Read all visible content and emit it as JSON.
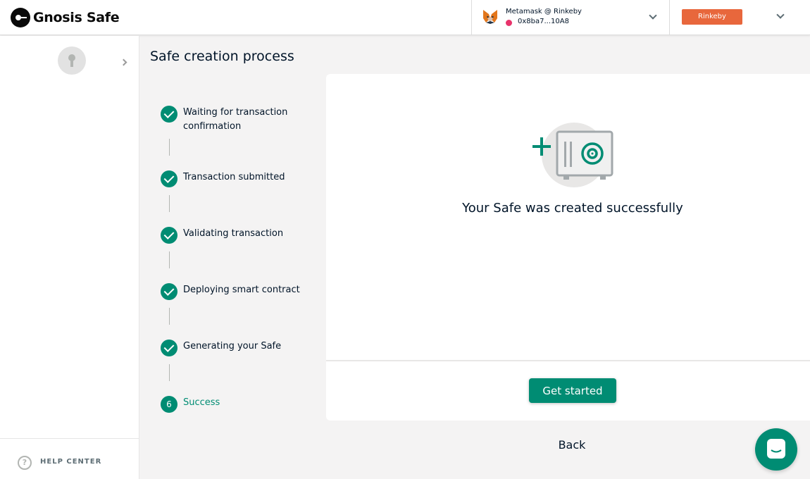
{
  "header": {
    "logo_text": "Gnosis Safe",
    "provider": {
      "name": "Metamask @ Rinkeby",
      "address": "0x8ba7...10A8",
      "status_color": "#e8336b"
    },
    "network": {
      "label": "Rinkeby",
      "color": "#e8673c"
    }
  },
  "sidebar": {
    "help_label": "HELP CENTER"
  },
  "main": {
    "title": "Safe creation process",
    "steps": [
      {
        "label": "Waiting for transaction confirmation",
        "status": "done"
      },
      {
        "label": "Transaction submitted",
        "status": "done"
      },
      {
        "label": "Validating transaction",
        "status": "done"
      },
      {
        "label": "Deploying smart contract",
        "status": "done"
      },
      {
        "label": "Generating your Safe",
        "status": "done"
      },
      {
        "label": "Success",
        "status": "active",
        "number": "6"
      }
    ],
    "success_message": "Your Safe was created successfully",
    "get_started_label": "Get started",
    "back_label": "Back"
  },
  "colors": {
    "accent": "#008c73",
    "text": "#001428"
  },
  "icons": {
    "logo": "gnosis-logo-icon",
    "provider": "metamask-fox-icon",
    "safe": "safe-vault-icon",
    "chat": "chat-icon",
    "help": "question-circle-icon"
  }
}
